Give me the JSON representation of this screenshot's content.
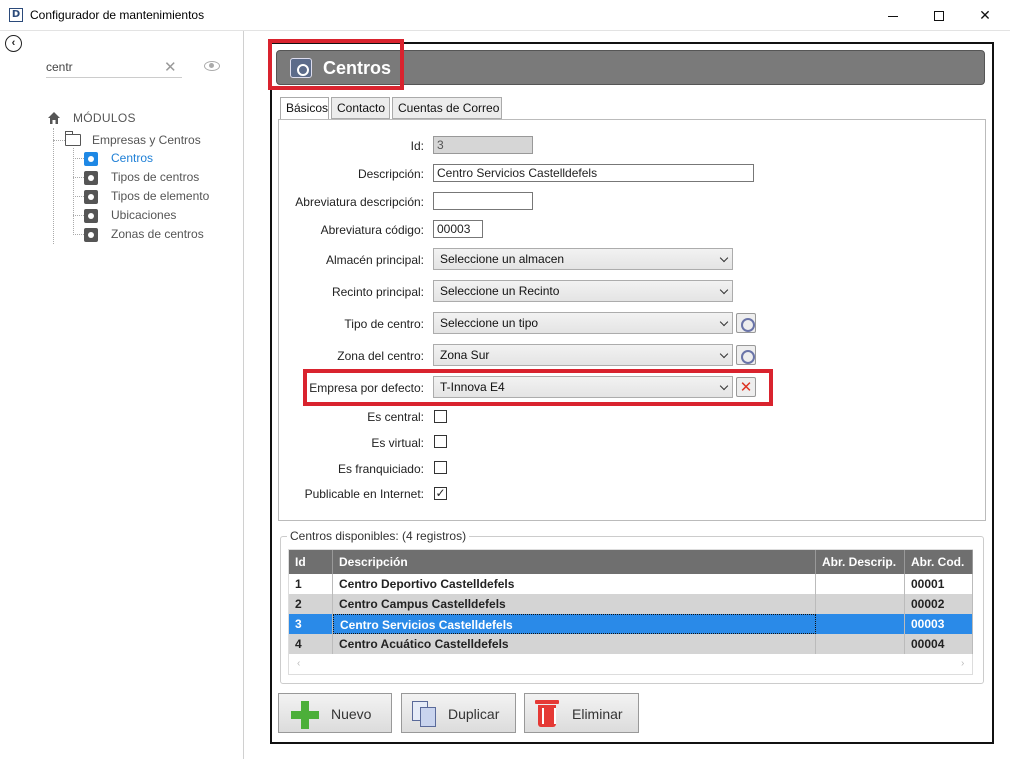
{
  "window": {
    "title": "Configurador de mantenimientos"
  },
  "sidebar": {
    "search_value": "centr",
    "tree": {
      "root_label": "MÓDULOS",
      "folder_label": "Empresas y Centros",
      "items": [
        {
          "label": "Centros",
          "active": true
        },
        {
          "label": "Tipos de centros",
          "active": false
        },
        {
          "label": "Tipos de elemento",
          "active": false
        },
        {
          "label": "Ubicaciones",
          "active": false
        },
        {
          "label": "Zonas de centros",
          "active": false
        }
      ]
    }
  },
  "header": {
    "title": "Centros"
  },
  "tabs": [
    "Básicos",
    "Contacto",
    "Cuentas de Correo"
  ],
  "form": {
    "id_label": "Id:",
    "id_value": "3",
    "descripcion_label": "Descripción:",
    "descripcion_value": "Centro Servicios Castelldefels",
    "abrev_desc_label": "Abreviatura descripción:",
    "abrev_desc_value": "",
    "abrev_cod_label": "Abreviatura código:",
    "abrev_cod_value": "00003",
    "almacen_label": "Almacén principal:",
    "almacen_value": "Seleccione un almacen",
    "recinto_label": "Recinto principal:",
    "recinto_value": "Seleccione un Recinto",
    "tipo_label": "Tipo de centro:",
    "tipo_value": "Seleccione un tipo",
    "zona_label": "Zona del centro:",
    "zona_value": "Zona Sur",
    "empresa_label": "Empresa por defecto:",
    "empresa_value": "T-Innova E4",
    "es_central_label": "Es central:",
    "es_central_checked": false,
    "es_virtual_label": "Es virtual:",
    "es_virtual_checked": false,
    "es_franquiciado_label": "Es franquiciado:",
    "es_franquiciado_checked": false,
    "publicable_label": "Publicable en Internet:",
    "publicable_checked": true,
    "check_mark": "✓"
  },
  "grid": {
    "title": "Centros disponibles:  (4 registros)",
    "columns": [
      "Id",
      "Descripción",
      "Abr. Descrip.",
      "Abr. Cod."
    ],
    "rows": [
      {
        "id": "1",
        "descripcion": "Centro Deportivo Castelldefels",
        "abr_desc": "",
        "abr_cod": "00001"
      },
      {
        "id": "2",
        "descripcion": "Centro Campus Castelldefels",
        "abr_desc": "",
        "abr_cod": "00002"
      },
      {
        "id": "3",
        "descripcion": "Centro Servicios Castelldefels",
        "abr_desc": "",
        "abr_cod": "00003"
      },
      {
        "id": "4",
        "descripcion": "Centro Acuático Castelldefels",
        "abr_desc": "",
        "abr_cod": "00004"
      }
    ],
    "selected_row": 2
  },
  "buttons": {
    "nuevo": "Nuevo",
    "duplicar": "Duplicar",
    "eliminar": "Eliminar"
  },
  "colors": {
    "highlight_red": "#d9232e",
    "selection_blue": "#2a8ae8",
    "header_gray": "#7a7a7a",
    "active_link": "#1e7fd6"
  }
}
